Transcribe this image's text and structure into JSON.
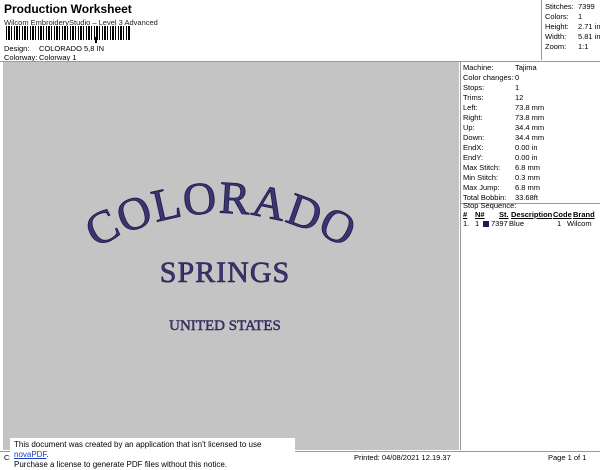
{
  "header": {
    "title": "Production Worksheet",
    "subtitle": "Wilcom EmbroideryStudio – Level 3 Advanced",
    "design_label": "Design:",
    "design_value": "COLORADO 5,8 IN",
    "colorway_label": "Colorway:",
    "colorway_value": "Colorway 1"
  },
  "summary": [
    {
      "label": "Stitches:",
      "value": "7399"
    },
    {
      "label": "Colors:",
      "value": "1"
    },
    {
      "label": "Height:",
      "value": "2.71 in"
    },
    {
      "label": "Width:",
      "value": "5.81 in"
    },
    {
      "label": "Zoom:",
      "value": "1:1"
    }
  ],
  "machine_info": [
    {
      "label": "Machine:",
      "value": "Tajima"
    },
    {
      "label": "Color changes:",
      "value": "0"
    },
    {
      "label": "Stops:",
      "value": "1"
    },
    {
      "label": "Trims:",
      "value": "12"
    },
    {
      "label": "Left:",
      "value": "73.8 mm"
    },
    {
      "label": "Right:",
      "value": "73.8 mm"
    },
    {
      "label": "Up:",
      "value": "34.4 mm"
    },
    {
      "label": "Down:",
      "value": "34.4 mm"
    },
    {
      "label": "EndX:",
      "value": "0.00 in"
    },
    {
      "label": "EndY:",
      "value": "0.00 in"
    },
    {
      "label": "Max Stitch:",
      "value": "6.8 mm"
    },
    {
      "label": "Min Stitch:",
      "value": "0.3 mm"
    },
    {
      "label": "Max Jump:",
      "value": "6.8 mm"
    },
    {
      "label": "Total Bobbin:",
      "value": "33.68ft"
    }
  ],
  "stop_sequence": {
    "title": "Stop Sequence:",
    "columns": [
      "#",
      "N#",
      "St.",
      "Description",
      "Code",
      "Brand"
    ],
    "rows": [
      {
        "num": "1.",
        "n": "1",
        "stitches": "7397",
        "description": "Blue",
        "code": "1",
        "brand": "Wilcom"
      }
    ]
  },
  "design_text": {
    "line1": "COLORADO",
    "line2": "SPRINGS",
    "line3": "UNITED STATES",
    "thread_color": "#3a3470"
  },
  "footer": {
    "left": "Cr",
    "printed": "Printed: 04/08/2021 12.19.37",
    "page": "Page 1 of 1"
  },
  "notice": {
    "line1_prefix": "This document was created by an application that isn't licensed to use ",
    "link": "novaPDF",
    "line1_suffix": ".",
    "line2": "Purchase a license to generate PDF files without this notice."
  }
}
